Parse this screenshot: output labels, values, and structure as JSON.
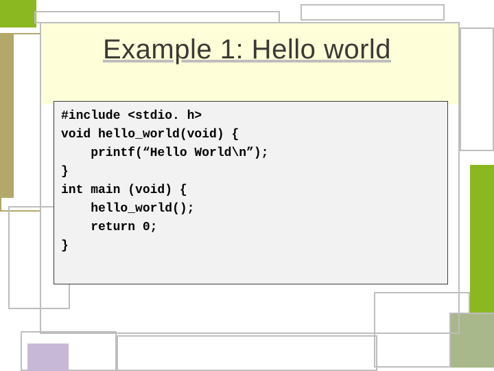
{
  "title": "Example 1: Hello world",
  "code": {
    "l1": "#include <stdio. h>",
    "l2": "",
    "l3": "void hello_world(void) {",
    "l4": "    printf(“Hello World\\n”);",
    "l5": "}",
    "l6": "",
    "l7": "int main (void) {",
    "l8": "    hello_world();",
    "l9": "    return 0;",
    "l10": "}"
  },
  "colors": {
    "green": "#8bb821",
    "olive": "#b3a76a",
    "sage": "#a8b88a",
    "lavender": "#c8b8d8",
    "cream": "#feffd8",
    "gray": "#bdbdbd"
  }
}
